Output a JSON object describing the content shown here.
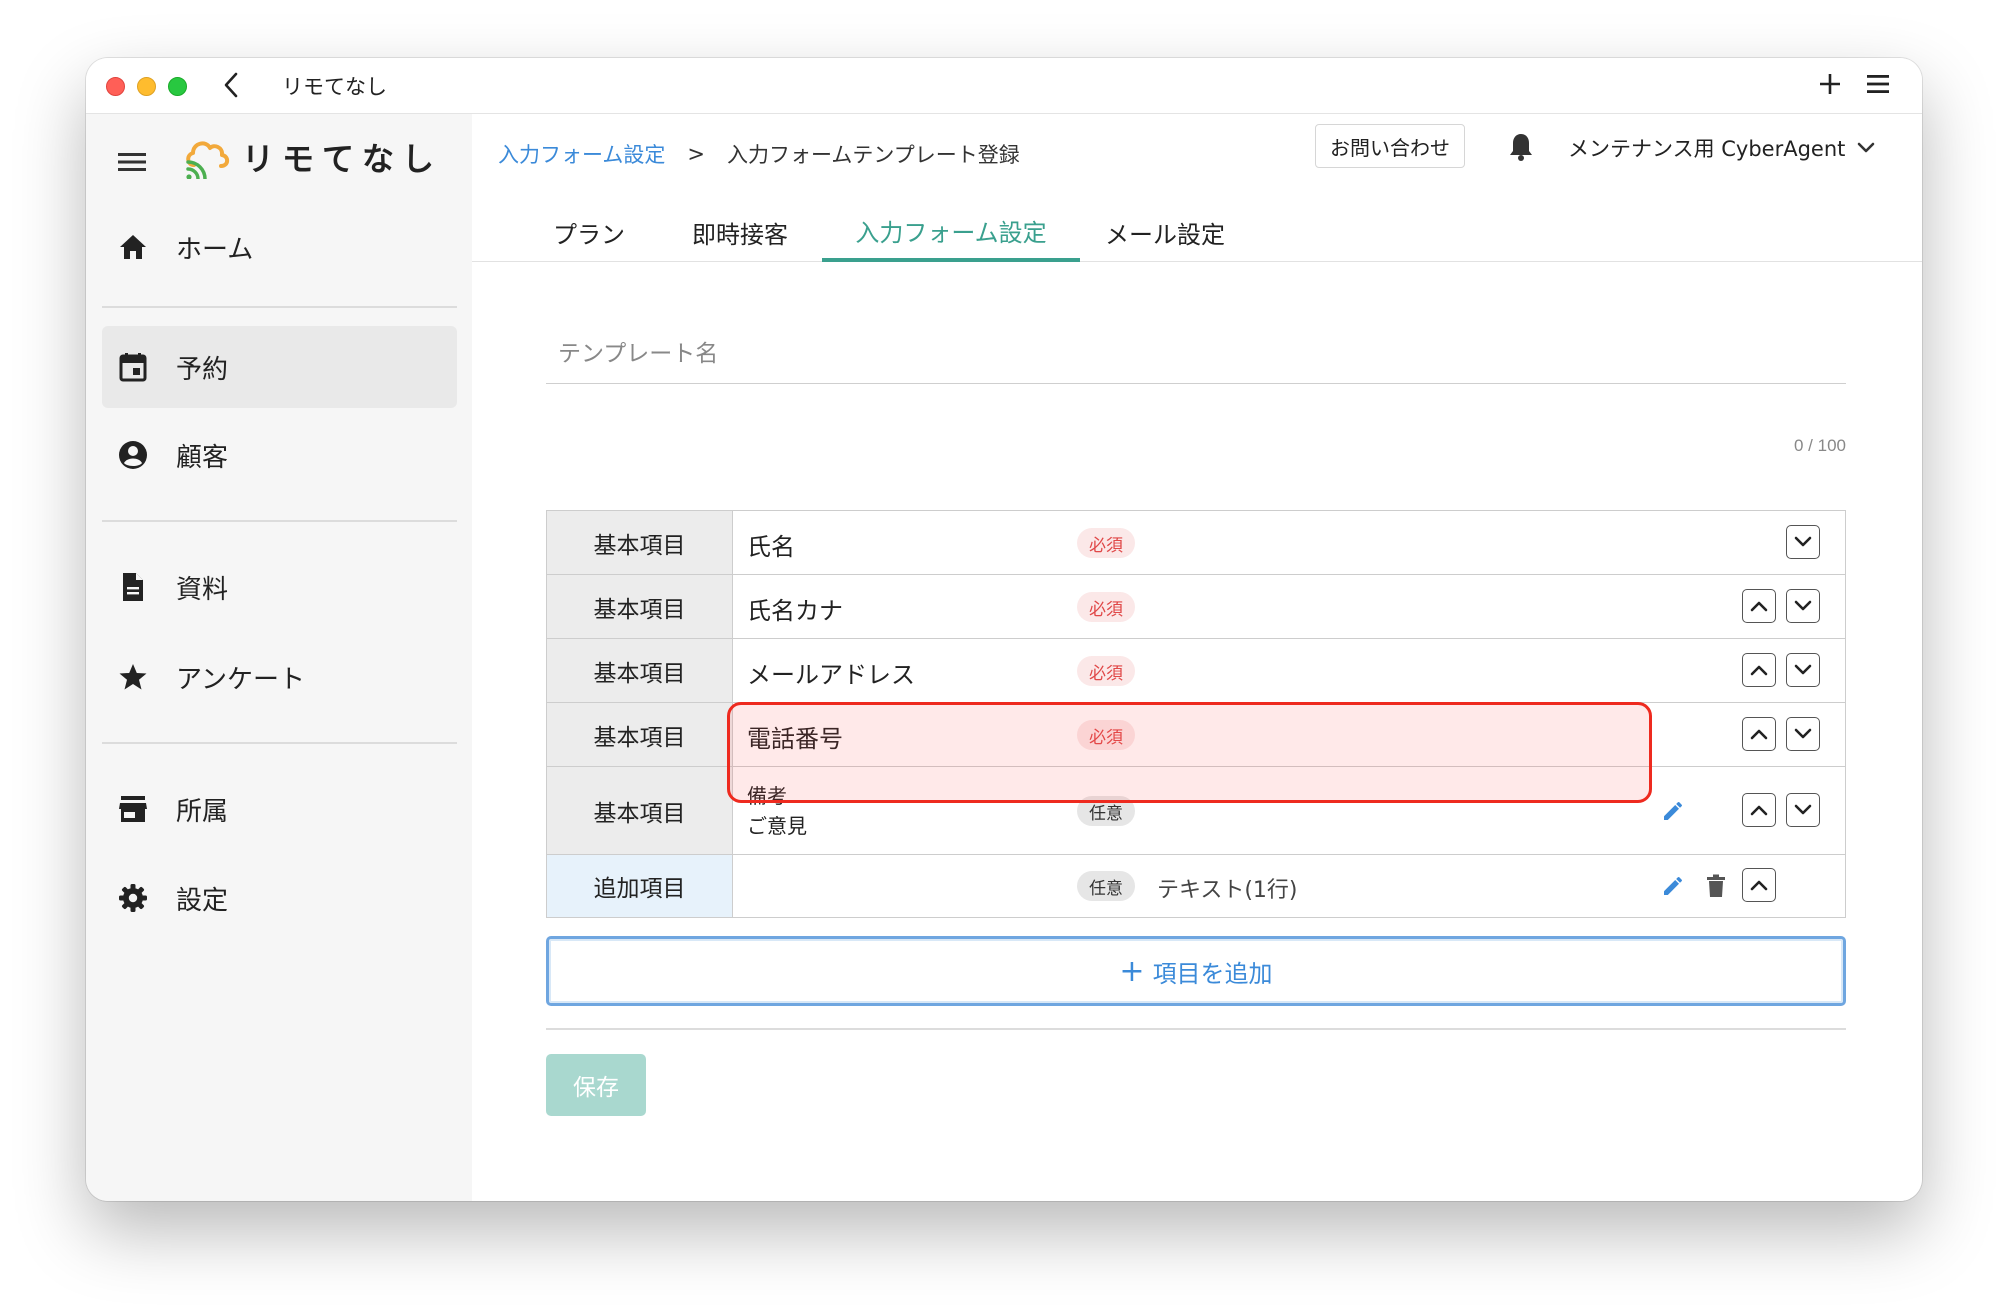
{
  "window": {
    "title": "リモてなし"
  },
  "sidebar": {
    "logo_text": "リモてなし",
    "items": [
      {
        "label": "ホーム",
        "icon": "home-icon"
      },
      {
        "label": "予約",
        "icon": "calendar-icon",
        "active": true
      },
      {
        "label": "顧客",
        "icon": "account-circle-icon"
      },
      {
        "label": "資料",
        "icon": "document-icon"
      },
      {
        "label": "アンケート",
        "icon": "star-icon"
      },
      {
        "label": "所属",
        "icon": "store-icon"
      },
      {
        "label": "設定",
        "icon": "gear-icon"
      }
    ]
  },
  "header": {
    "breadcrumb": {
      "link": "入力フォーム設定",
      "separator": ">",
      "current": "入力フォームテンプレート登録"
    },
    "contact_label": "お問い合わせ",
    "account_name": "メンテナンス用 CyberAgent"
  },
  "tabs": [
    {
      "label": "プラン"
    },
    {
      "label": "即時接客"
    },
    {
      "label": "入力フォーム設定",
      "active": true
    },
    {
      "label": "メール設定"
    }
  ],
  "form": {
    "template_name_placeholder": "テンプレート名",
    "template_name_value": "",
    "counter": "0 / 100",
    "rows": [
      {
        "type": "基本項目",
        "name": "氏名",
        "badge": "必須",
        "badge_kind": "required"
      },
      {
        "type": "基本項目",
        "name": "氏名カナ",
        "badge": "必須",
        "badge_kind": "required"
      },
      {
        "type": "基本項目",
        "name": "メールアドレス",
        "badge": "必須",
        "badge_kind": "required"
      },
      {
        "type": "基本項目",
        "name": "電話番号",
        "badge": "必須",
        "badge_kind": "required"
      },
      {
        "type": "基本項目",
        "name_line1": "備考",
        "name_line2": "ご意見",
        "badge": "任意",
        "badge_kind": "optional"
      },
      {
        "type": "追加項目",
        "name": "",
        "badge": "任意",
        "badge_kind": "optional",
        "field_type": "テキスト(1行)"
      }
    ],
    "add_button_label": "項目を追加",
    "save_label": "保存"
  },
  "colors": {
    "accent_green": "#3aa08e",
    "link_blue": "#3b8ad9",
    "required_red": "#e04848",
    "highlight_red": "#ee2a1f",
    "save_disabled": "#a9d8cf"
  }
}
